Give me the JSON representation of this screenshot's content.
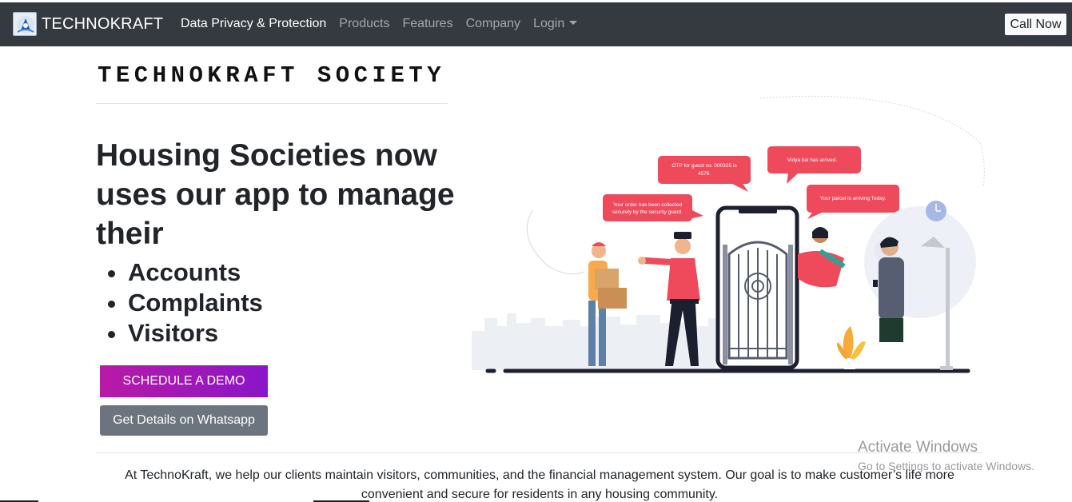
{
  "navbar": {
    "brand": "TECHNOKRAFT",
    "links": [
      {
        "label": "Data Privacy & Protection",
        "active": true
      },
      {
        "label": "Products",
        "active": false
      },
      {
        "label": "Features",
        "active": false
      },
      {
        "label": "Company",
        "active": false
      },
      {
        "label": "Login",
        "active": false,
        "dropdown": true
      }
    ],
    "call_button": "Call Now"
  },
  "hero": {
    "society_title": "TECHNOKRAFT SOCIETY",
    "headline": "Housing Societies now uses our app to manage their",
    "features": [
      "Accounts",
      "Complaints",
      "Visitors"
    ],
    "demo_button": "SCHEDULE A DEMO",
    "whatsapp_button": "Get Details on Whatsapp"
  },
  "illustration": {
    "bubbles": [
      {
        "line1": "OTP for guest no. 000325 is",
        "line2": "4576."
      },
      {
        "line1": "Vidya bai has arrived.",
        "line2": ""
      },
      {
        "line1": "Your order has been collected",
        "line2": "securely by the security guard."
      },
      {
        "line1": "Your parcel is arriving Today.",
        "line2": ""
      }
    ]
  },
  "about": {
    "text": "At TechnoKraft, we help our clients maintain visitors, communities, and the financial management system. Our goal is to make customer’s life more convenient and secure for residents in any housing community."
  },
  "watermark": {
    "title": "Activate Windows",
    "subtitle": "Go to Settings to activate Windows."
  },
  "colors": {
    "navbar_bg": "#343a40",
    "demo_gradient_start": "#b81aa6",
    "demo_gradient_end": "#8a15c9",
    "whatsapp_btn": "#6c757d",
    "bubble_red": "#ee4a5c"
  }
}
